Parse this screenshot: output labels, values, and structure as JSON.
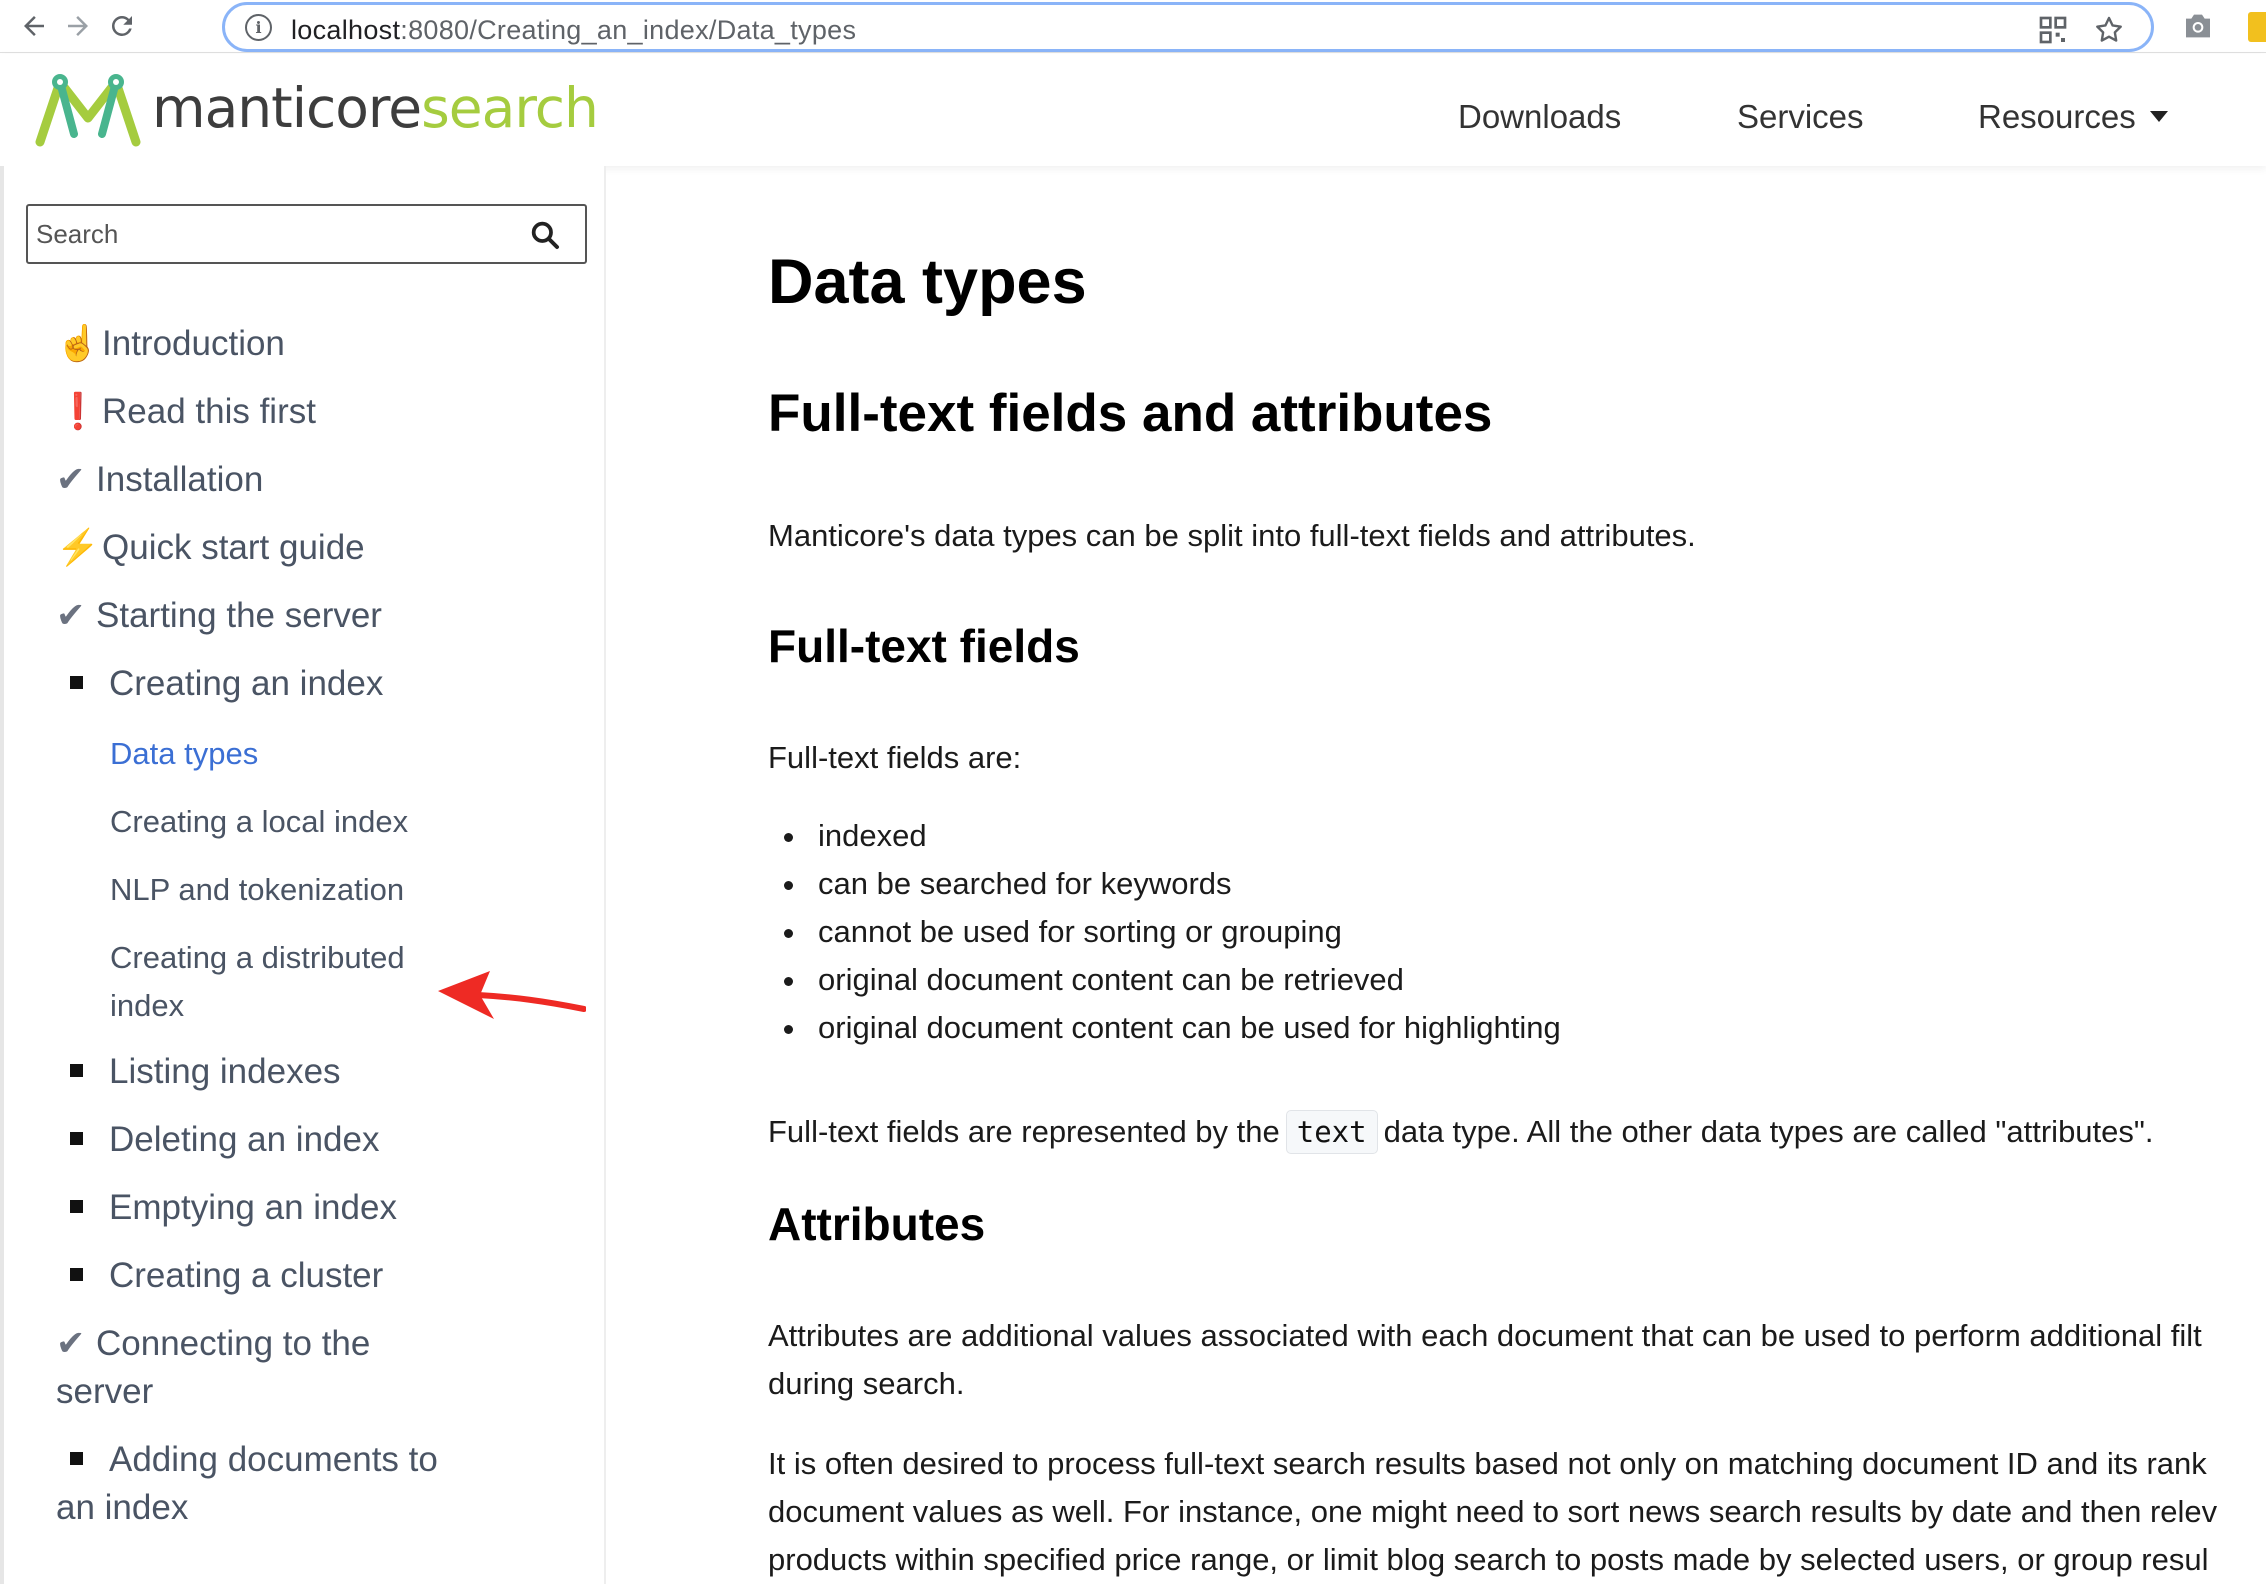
{
  "browser": {
    "url_host": "localhost",
    "url_path": ":8080/Creating_an_index/Data_types"
  },
  "header": {
    "logo_part1": "manticore",
    "logo_part2": "search",
    "nav": [
      {
        "label": "Downloads"
      },
      {
        "label": "Services"
      },
      {
        "label": "Resources"
      }
    ]
  },
  "sidebar": {
    "search_placeholder": "Search",
    "items": [
      {
        "glyph": "☝",
        "label": "Introduction"
      },
      {
        "glyph": "❗",
        "label": "Read this first"
      },
      {
        "glyph": "✔",
        "label": "Installation"
      },
      {
        "glyph": "⚡",
        "label": "Quick start guide"
      },
      {
        "glyph": "✔",
        "label": "Starting the server"
      },
      {
        "glyph": "■",
        "label": "Creating an index"
      },
      {
        "glyph": "■",
        "label": "Listing indexes"
      },
      {
        "glyph": "■",
        "label": "Deleting an index"
      },
      {
        "glyph": "■",
        "label": "Emptying an index"
      },
      {
        "glyph": "■",
        "label": "Creating a cluster"
      },
      {
        "glyph": "✔",
        "label_line1": "Connecting to the",
        "label_line2": "server"
      },
      {
        "glyph": "■",
        "label_line1": "Adding documents to",
        "label_line2": "an index"
      }
    ],
    "subitems": [
      {
        "label": "Data types"
      },
      {
        "label": "Creating a local index"
      },
      {
        "label": "NLP and tokenization"
      },
      {
        "label_line1": "Creating a distributed",
        "label_line2": "index"
      }
    ]
  },
  "content": {
    "title": "Data types",
    "section1": "Full-text fields and attributes",
    "intro": "Manticore's data types can be split into full-text fields and attributes.",
    "sub1": "Full-text fields",
    "fields_are": "Full-text fields are:",
    "field_props": [
      "indexed",
      "can be searched for keywords",
      "cannot be used for sorting or grouping",
      "original document content can be retrieved",
      "original document content can be used for highlighting"
    ],
    "represented_pre": "Full-text fields are represented by the",
    "represented_code": "text",
    "represented_post": "data type. All the other data types are called \"attributes\".",
    "sub2": "Attributes",
    "attr_p1_line1": "Attributes are additional values associated with each document that can be used to perform additional filt",
    "attr_p1_line2": "during search.",
    "attr_p2_line1": "It is often desired to process full-text search results based not only on matching document ID and its rank",
    "attr_p2_line2": "document values as well. For instance, one might need to sort news search results by date and then relev",
    "attr_p2_line3": "products within specified price range, or limit blog search to posts made by selected users, or group resul"
  }
}
